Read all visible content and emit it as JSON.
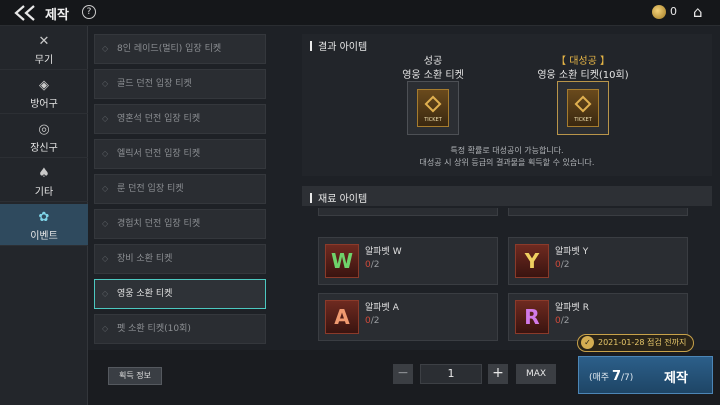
{
  "header": {
    "title": "제작",
    "help_icon": "?",
    "coin_count": "0"
  },
  "categories": [
    {
      "label": "무기",
      "icon": "crossed-swords-icon"
    },
    {
      "label": "방어구",
      "icon": "armor-icon"
    },
    {
      "label": "장신구",
      "icon": "ring-icon"
    },
    {
      "label": "기타",
      "icon": "potion-icon"
    },
    {
      "label": "이벤트",
      "icon": "event-icon"
    }
  ],
  "tickets": [
    "8인 레이드(멀티) 입장 티켓",
    "골드 던전 입장 티켓",
    "영혼석 던전 입장 티켓",
    "엘릭서 던전 입장 티켓",
    "룬 던전 입장 티켓",
    "경험치 던전 입장 티켓",
    "장비 소환 티켓",
    "영웅 소환 티켓",
    "펫 소환 티켓(10회)"
  ],
  "result": {
    "heading": "결과 아이템",
    "success_label": "성공",
    "success_item": "영웅 소환 티켓",
    "great_label": "【 대성공 】",
    "great_item": "영웅 소환 티켓(10회)",
    "ticket_text": "TICKET",
    "note_line1": "특정 확률로 대성공이 가능합니다.",
    "note_line2": "대성공 시 상위 등급의 결과물을 획득할 수 있습니다."
  },
  "materials": {
    "heading": "재료 아이템",
    "items": [
      {
        "letter": "W",
        "name": "알파벳 W",
        "have": "0",
        "need": "/2",
        "color": "#6fd36a"
      },
      {
        "letter": "Y",
        "name": "알파벳 Y",
        "have": "0",
        "need": "/2",
        "color": "#f0d060"
      },
      {
        "letter": "A",
        "name": "알파벳 A",
        "have": "0",
        "need": "/2",
        "color": "#f09a70"
      },
      {
        "letter": "R",
        "name": "알파벳 R",
        "have": "0",
        "need": "/2",
        "color": "#d27ae8"
      }
    ]
  },
  "footer": {
    "acquire_label": "획득 정보",
    "minus": "−",
    "quantity": "1",
    "plus": "+",
    "max_label": "MAX",
    "badge_text": "2021-01-28 점검 전까지",
    "weekly_prefix": "(매주",
    "weekly_count": "7",
    "weekly_total": "/7)",
    "craft_label": "제작"
  }
}
